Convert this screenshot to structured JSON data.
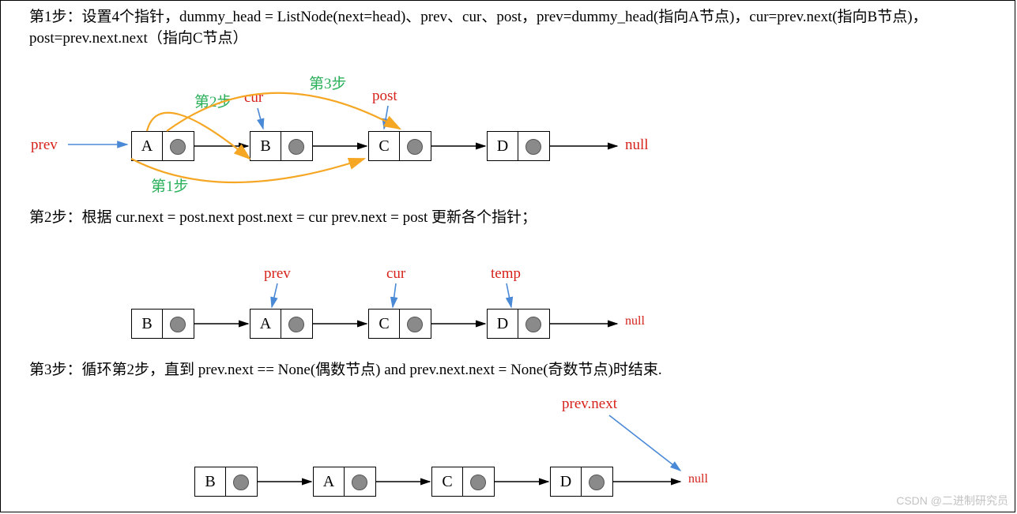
{
  "step1": {
    "text": "第1步：设置4个指针，dummy_head = ListNode(next=head)、prev、cur、post，prev=dummy_head(指向A节点)，cur=prev.next(指向B节点)，post=prev.next.next（指向C节点）",
    "labels": {
      "prev": "prev",
      "cur": "cur",
      "post": "post",
      "null": "null",
      "s1": "第1步",
      "s2": "第2步",
      "s3": "第3步"
    },
    "nodes": [
      "A",
      "B",
      "C",
      "D"
    ]
  },
  "step2": {
    "text": "第2步：根据 cur.next = post.next  post.next = cur  prev.next = post 更新各个指针；",
    "labels": {
      "prev": "prev",
      "cur": "cur",
      "temp": "temp",
      "null": "null"
    },
    "nodes": [
      "B",
      "A",
      "C",
      "D"
    ]
  },
  "step3": {
    "text": "第3步：循环第2步，直到 prev.next == None(偶数节点) and prev.next.next = None(奇数节点)时结束.",
    "labels": {
      "prevnext": "prev.next",
      "null": "null"
    },
    "nodes": [
      "B",
      "A",
      "C",
      "D"
    ]
  },
  "watermark": "CSDN @二进制研究员"
}
